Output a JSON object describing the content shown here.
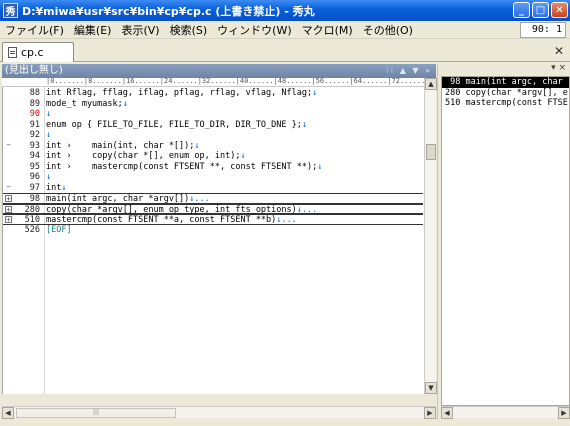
{
  "window": {
    "title": "D:¥miwa¥usr¥src¥bin¥cp¥cp.c (上書き禁止) - 秀丸",
    "app_icon": "秀",
    "buttons": [
      "_",
      "□",
      "✕"
    ]
  },
  "menu": {
    "items": [
      "ファイル(F)",
      "編集(E)",
      "表示(V)",
      "検索(S)",
      "ウィンドウ(W)",
      "マクロ(M)",
      "その他(O)"
    ],
    "cursor_position": "90: 1"
  },
  "tab": {
    "label": "cp.c",
    "close": "✕"
  },
  "editor": {
    "header": "(見出し無し)",
    "header_tools": "⁝⁝ ▲ ▼ »",
    "ruler": "|0.......|8.......|16......|24......|32......|40......|48......|56......|64......|72......",
    "lines": [
      {
        "num": "88",
        "text": "int Rflag, fflag, iflag, pflag, rflag, vflag, Nflag;",
        "cr": "↓",
        "fold": "",
        "red": false,
        "folded": false
      },
      {
        "num": "89",
        "text": "mode_t myumask;",
        "cr": "↓",
        "fold": "",
        "red": false,
        "folded": false
      },
      {
        "num": "90",
        "text": "",
        "cr": "↓",
        "fold": "",
        "red": true,
        "folded": false
      },
      {
        "num": "91",
        "text": "enum op { FILE_TO_FILE, FILE_TO_DIR, DIR_TO_DNE };",
        "cr": "↓",
        "fold": "",
        "red": false,
        "folded": false
      },
      {
        "num": "92",
        "text": "",
        "cr": "↓",
        "fold": "",
        "red": false,
        "folded": false
      },
      {
        "num": "93",
        "text": "int ›    main(int, char *[]);",
        "cr": "↓",
        "fold": "−",
        "red": false,
        "folded": false
      },
      {
        "num": "94",
        "text": "int ›    copy(char *[], enum op, int);",
        "cr": "↓",
        "fold": "",
        "red": false,
        "folded": false
      },
      {
        "num": "95",
        "text": "int ›    mastercmp(const FTSENT **, const FTSENT **);",
        "cr": "↓",
        "fold": "",
        "red": false,
        "folded": false
      },
      {
        "num": "96",
        "text": "",
        "cr": "↓",
        "fold": "",
        "red": false,
        "folded": false
      },
      {
        "num": "97",
        "text": "int",
        "cr": "↓",
        "fold": "−",
        "red": false,
        "folded": false
      },
      {
        "num": "98",
        "text": "main(int argc, char *argv[])",
        "cr": "↓...",
        "fold": "+",
        "red": false,
        "folded": true
      },
      {
        "num": "280",
        "text": "copy(char *argv[], enum op type, int fts_options)",
        "cr": "↓...",
        "fold": "+",
        "red": false,
        "folded": true
      },
      {
        "num": "510",
        "text": "mastercmp(const FTSENT **a, const FTSENT **b)",
        "cr": "↓...",
        "fold": "+",
        "red": false,
        "folded": true
      },
      {
        "num": "526",
        "text": "[EOF]",
        "cr": "",
        "fold": "",
        "red": false,
        "folded": false,
        "eof": true
      }
    ],
    "hscroll_thumb": "|||"
  },
  "outline": {
    "pin": "▾ ×",
    "rows": [
      {
        "text": " 98 main(int argc, char",
        "selected": true
      },
      {
        "text": "280 copy(char *argv[], e",
        "selected": false
      },
      {
        "text": "510 mastercmp(const FTSE",
        "selected": false
      }
    ]
  },
  "colors": {
    "titlebar": "#0a5fd8",
    "line_number_red": "#d00000",
    "cr_mark": "#0066cc",
    "eof": "#1a7a7a",
    "outline_selected": "#000000"
  }
}
